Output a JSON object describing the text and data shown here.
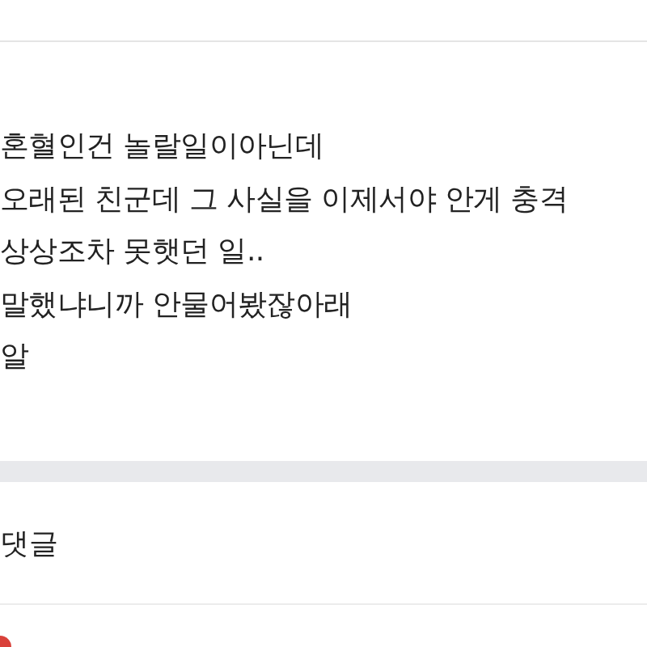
{
  "post": {
    "lines": [
      "혼혈인건 놀랄일이아닌데",
      "오래된 친군데 그 사실을 이제서야 안게 충격",
      "상상조차 못햇던 일..",
      "말했냐니까 안물어봤잖아래",
      "알"
    ]
  },
  "comments": {
    "heading": "댓글"
  }
}
